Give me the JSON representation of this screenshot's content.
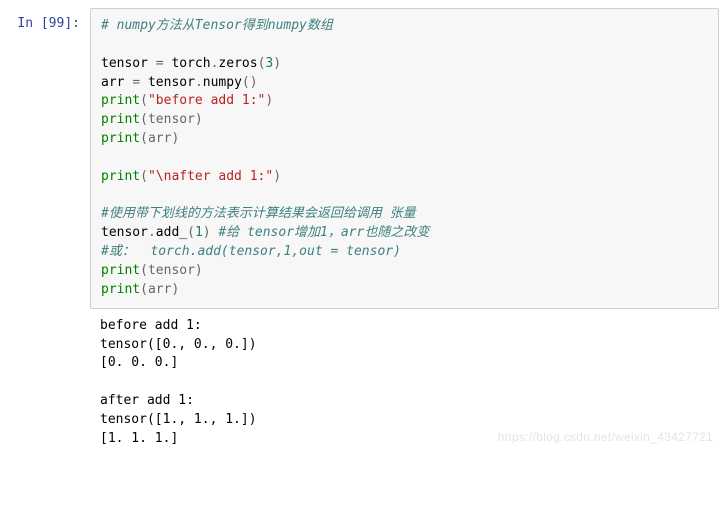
{
  "prompt": {
    "label": "In  [99]:"
  },
  "code": {
    "c1": "# numpy方法从Tensor得到numpy数组",
    "l3_a": "tensor",
    "l3_b": "=",
    "l3_c": "torch",
    "l3_d": ".",
    "l3_e": "zeros",
    "l3_f": "(",
    "l3_g": "3",
    "l3_h": ")",
    "l4_a": "arr",
    "l4_b": "=",
    "l4_c": "tensor",
    "l4_d": ".",
    "l4_e": "numpy",
    "l4_f": "()",
    "l5_a": "print",
    "l5_b": "(",
    "l5_c": "\"before add 1:\"",
    "l5_d": ")",
    "l6_a": "print",
    "l6_b": "(tensor)",
    "l7_a": "print",
    "l7_b": "(arr)",
    "l9_a": "print",
    "l9_b": "(",
    "l9_c": "\"\\nafter add 1:\"",
    "l9_d": ")",
    "c2": "#使用带下划线的方法表示计算结果会返回给调用 张量",
    "l12_a": "tensor",
    "l12_b": ".",
    "l12_c": "add_",
    "l12_d": "(",
    "l12_e": "1",
    "l12_f": ")",
    "l12_g": " #给 tensor增加1，arr也随之改变",
    "c3": "#或：  torch.add(tensor,1,out = tensor)",
    "l14_a": "print",
    "l14_b": "(tensor)",
    "l15_a": "print",
    "l15_b": "(arr)"
  },
  "output": {
    "l1": "before add 1:",
    "l2": "tensor([0., 0., 0.])",
    "l3": "[0. 0. 0.]",
    "l5": "after add 1:",
    "l6": "tensor([1., 1., 1.])",
    "l7": "[1. 1. 1.]"
  },
  "watermark": "https://blog.csdn.net/weixin_43427721"
}
